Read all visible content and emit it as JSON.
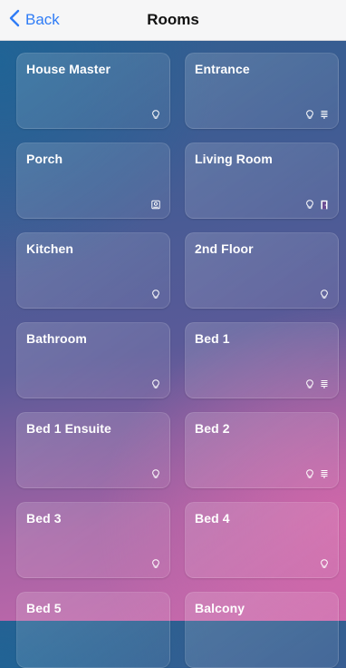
{
  "navbar": {
    "back_label": "Back",
    "title": "Rooms"
  },
  "colors": {
    "accent": "#2f7cf6"
  },
  "rooms": [
    {
      "name": "House Master",
      "icons": [
        "lightbulb-icon"
      ]
    },
    {
      "name": "Entrance",
      "icons": [
        "lightbulb-icon",
        "blinds-icon"
      ]
    },
    {
      "name": "Porch",
      "icons": [
        "camera-icon"
      ]
    },
    {
      "name": "Living Room",
      "icons": [
        "lightbulb-icon",
        "door-icon"
      ]
    },
    {
      "name": "Kitchen",
      "icons": [
        "lightbulb-icon"
      ]
    },
    {
      "name": "2nd Floor",
      "icons": [
        "lightbulb-icon"
      ]
    },
    {
      "name": "Bathroom",
      "icons": [
        "lightbulb-icon"
      ]
    },
    {
      "name": "Bed 1",
      "icons": [
        "lightbulb-icon",
        "blinds-icon"
      ]
    },
    {
      "name": "Bed 1 Ensuite",
      "icons": [
        "lightbulb-icon"
      ]
    },
    {
      "name": "Bed 2",
      "icons": [
        "lightbulb-icon",
        "blinds-icon"
      ]
    },
    {
      "name": "Bed 3",
      "icons": [
        "lightbulb-icon"
      ]
    },
    {
      "name": "Bed 4",
      "icons": [
        "lightbulb-icon"
      ]
    },
    {
      "name": "Bed 5",
      "icons": []
    },
    {
      "name": "Balcony",
      "icons": []
    }
  ]
}
